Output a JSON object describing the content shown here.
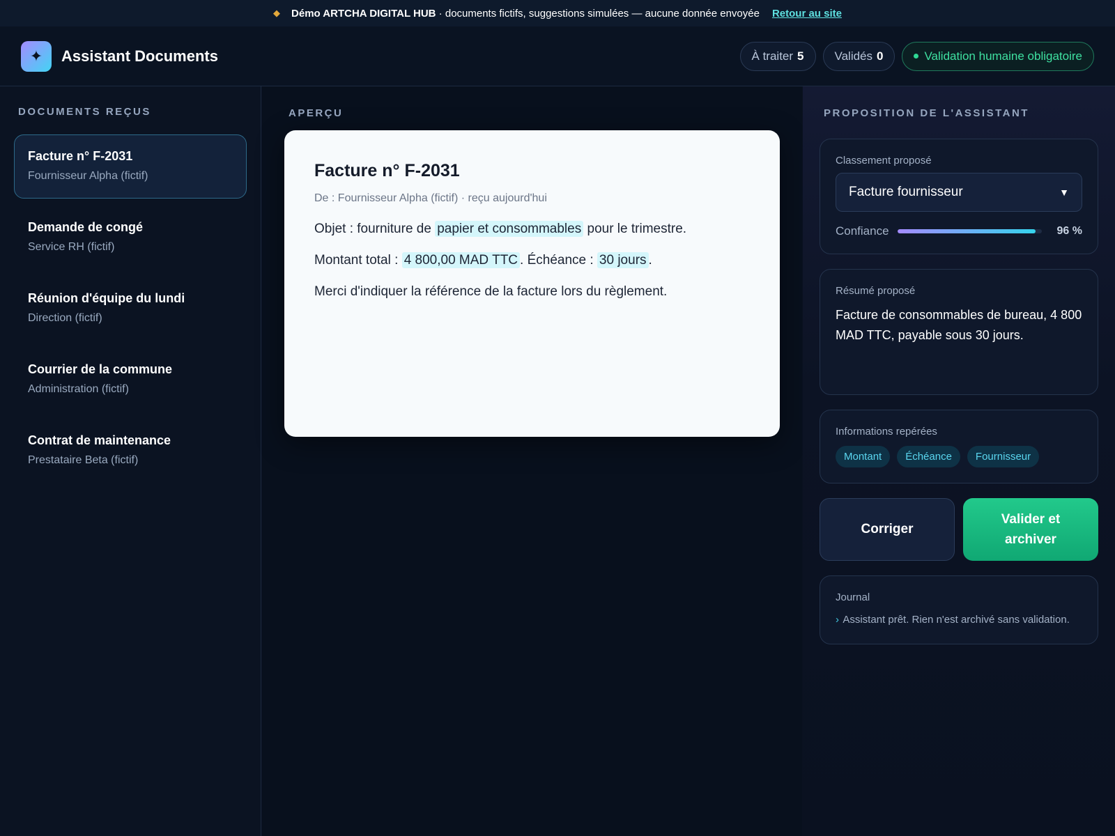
{
  "banner": {
    "icon": "diamond-icon",
    "message_bold": "Démo ARTCHA DIGITAL HUB",
    "message_rest": " · documents fictifs, suggestions simulées — aucune donnée envoyée",
    "link_label": "Retour au site"
  },
  "header": {
    "logo_icon": "sparkle-icon",
    "title": "Assistant Documents",
    "counters": [
      {
        "label": "À traiter",
        "value": "5"
      },
      {
        "label": "Validés",
        "value": "0"
      }
    ],
    "validation_badge": "Validation humaine obligatoire"
  },
  "sidebar": {
    "section_label": "Documents reçus",
    "items": [
      {
        "title": "Facture n° F-2031",
        "subtitle": "Fournisseur Alpha (fictif)"
      },
      {
        "title": "Demande de congé",
        "subtitle": "Service RH (fictif)"
      },
      {
        "title": "Réunion d'équipe du lundi",
        "subtitle": "Direction (fictif)"
      },
      {
        "title": "Courrier de la commune",
        "subtitle": "Administration (fictif)"
      },
      {
        "title": "Contrat de maintenance",
        "subtitle": "Prestataire Beta (fictif)"
      }
    ]
  },
  "preview": {
    "section_label": "Aperçu",
    "document": {
      "title": "Facture n° F-2031",
      "meta": "De : Fournisseur Alpha (fictif) · reçu aujourd'hui",
      "line1_a": "Objet : fourniture de ",
      "line1_hl": "papier et consommables",
      "line1_b": " pour le trimestre.",
      "line2_a": "Montant total : ",
      "line2_hl1": "4 800,00 MAD TTC",
      "line2_b": ". Échéance : ",
      "line2_hl2": "30 jours",
      "line2_c": ".",
      "line3": "Merci d'indiquer la référence de la facture lors du règlement."
    }
  },
  "assistant": {
    "section_label": "Proposition de l'assistant",
    "classification": {
      "label": "Classement proposé",
      "selected": "Facture fournisseur",
      "confidence_label": "Confiance",
      "confidence_percent": 96,
      "confidence_text": "96 %"
    },
    "summary": {
      "label": "Résumé proposé",
      "text": "Facture de consommables de bureau, 4 800 MAD TTC, payable sous 30 jours."
    },
    "info": {
      "label": "Informations repérées",
      "tags": [
        "Montant",
        "Échéance",
        "Fournisseur"
      ]
    },
    "actions": {
      "correct_label": "Corriger",
      "validate_line1": "Valider et",
      "validate_line2": "archiver"
    },
    "journal": {
      "label": "Journal",
      "entry": "Assistant prêt. Rien n'est archivé sans validation."
    }
  },
  "colors": {
    "background": "#0a1120",
    "accent_cyan": "#5ee0e0",
    "accent_green": "#22c98b",
    "highlight": "#d4f6fb"
  }
}
